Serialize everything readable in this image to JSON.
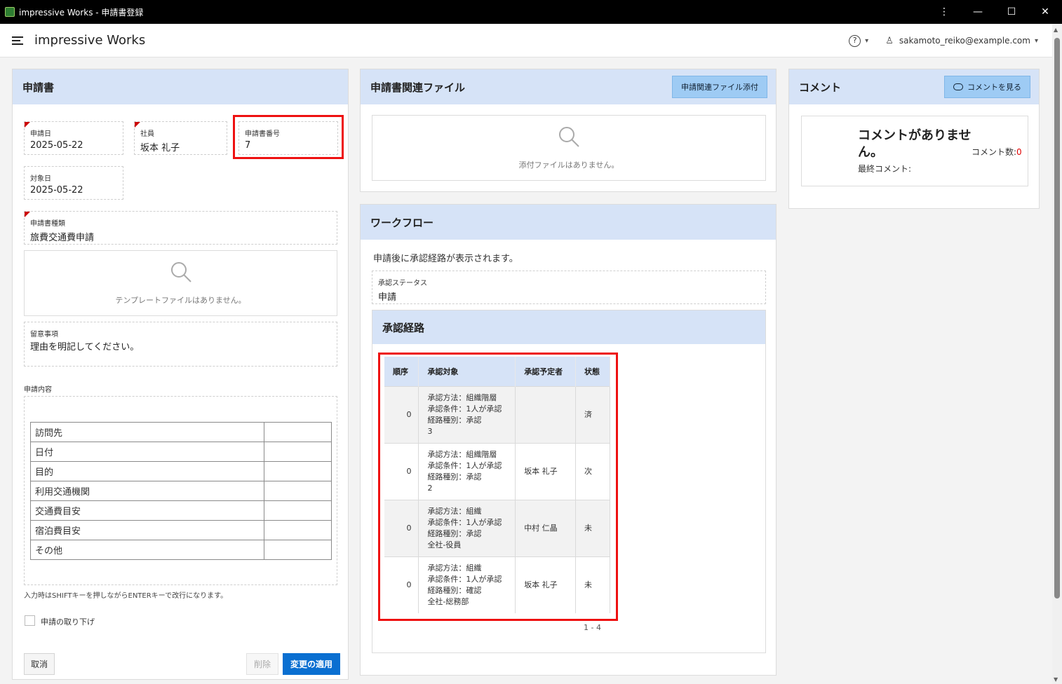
{
  "window": {
    "title": "impressive Works - 申請書登録",
    "controls": [
      "⋮",
      "—",
      "☐",
      "✕"
    ]
  },
  "header": {
    "app_name": "impressive Works",
    "help_symbol": "?",
    "user": "sakamoto_reiko@example.com"
  },
  "form_panel": {
    "title": "申請書",
    "apply_date": {
      "label": "申請日",
      "value": "2025-05-22"
    },
    "employee": {
      "label": "社員",
      "value": "坂本 礼子"
    },
    "app_number": {
      "label": "申請書番号",
      "value": "7"
    },
    "target_date": {
      "label": "対象日",
      "value": "2025-05-22"
    },
    "app_type": {
      "label": "申請書種類",
      "value": "旅費交通費申請"
    },
    "template_empty": "テンプレートファイルはありません。",
    "notes": {
      "label": "留意事項",
      "value": "理由を明記してください。"
    },
    "content_label": "申請内容",
    "content_rows": [
      "訪問先",
      "日付",
      "目的",
      "利用交通機関",
      "交通費目安",
      "宿泊費目安",
      "その他"
    ],
    "hint": "入力時はSHIFTキーを押しながらENTERキーで改行になります。",
    "withdraw_label": "申請の取り下げ",
    "cancel_label": "取消",
    "delete_label": "削除",
    "apply_label": "変更の適用"
  },
  "files_panel": {
    "title": "申請書関連ファイル",
    "attach_button": "申請関連ファイル添付",
    "empty": "添付ファイルはありません。"
  },
  "workflow_panel": {
    "title": "ワークフロー",
    "note": "申請後に承認経路が表示されます。",
    "status": {
      "label": "承認ステータス",
      "value": "申請"
    },
    "route_title": "承認経路",
    "columns": [
      "順序",
      "承認対象",
      "承認予定者",
      "状態"
    ],
    "rows": [
      {
        "order": "0",
        "target": [
          "承認方法：組織階層",
          "承認条件：1人が承認",
          "経路種別：承認",
          "3"
        ],
        "approver": "",
        "status": "済"
      },
      {
        "order": "0",
        "target": [
          "承認方法：組織階層",
          "承認条件：1人が承認",
          "経路種別：承認",
          "2"
        ],
        "approver": "坂本 礼子",
        "status": "次"
      },
      {
        "order": "0",
        "target": [
          "承認方法：組織",
          "承認条件：1人が承認",
          "経路種別：承認",
          "全社-役員"
        ],
        "approver": "中村 仁晶",
        "status": "未"
      },
      {
        "order": "0",
        "target": [
          "承認方法：組織",
          "承認条件：1人が承認",
          "経路種別：確認",
          "全社-総務部"
        ],
        "approver": "坂本 礼子",
        "status": "未"
      }
    ],
    "pagination": "1 - 4"
  },
  "comment_panel": {
    "title": "コメント",
    "view_button": "コメントを見る",
    "none_line1": "コメントがありませ",
    "none_line2": "ん。",
    "last_comment_label": "最終コメント:",
    "count_label": "コメント数:",
    "count_value": "0",
    "count_color": "#e00000"
  },
  "colors": {
    "panel_header": "#d6e3f7",
    "primary_button": "#0a6fd1",
    "highlight_box": "#e11111"
  }
}
